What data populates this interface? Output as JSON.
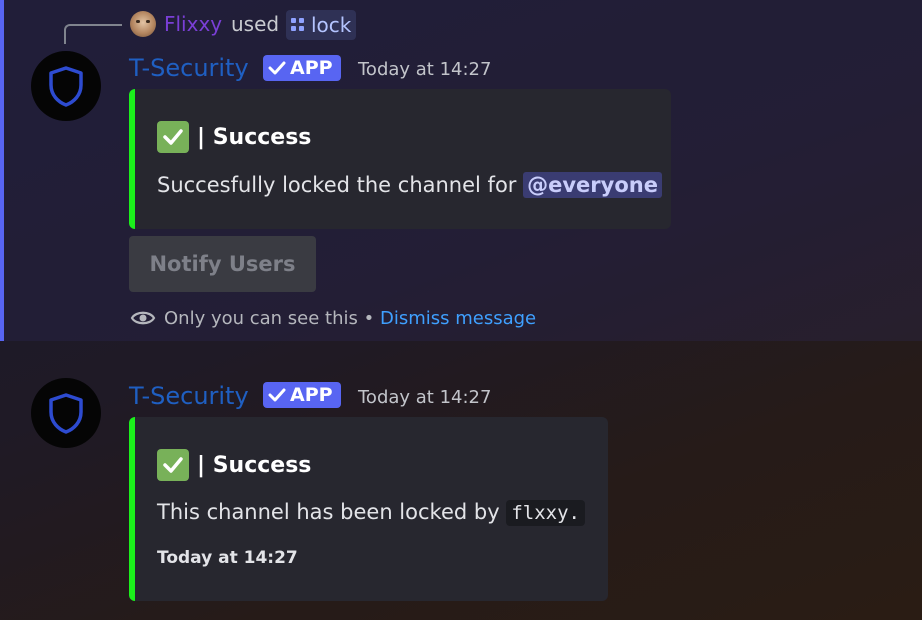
{
  "reply": {
    "user_name": "Flixxy",
    "used_text": "used",
    "command": "lock"
  },
  "messages": [
    {
      "bot_name": "T-Security",
      "badge": "APP",
      "timestamp": "Today at 14:27",
      "embed": {
        "title": "| Success",
        "description": "Succesfully locked the channel for ",
        "mention": "@everyone"
      },
      "button": "Notify Users",
      "ephemeral": {
        "text": "Only you can see this • ",
        "dismiss": "Dismiss message"
      }
    },
    {
      "bot_name": "T-Security",
      "badge": "APP",
      "timestamp": "Today at 14:27",
      "embed": {
        "title": "| Success",
        "description": "This channel has been locked by ",
        "code": "flxxy.",
        "footer": "Today at 14:27"
      }
    }
  ],
  "colors": {
    "accent": "#5865f2",
    "embed_border": "#1bf01b",
    "bot_name": "#1f5fc2",
    "reply_name": "#7a3fd6",
    "link": "#3fa0ff"
  },
  "icons": [
    "shield-icon",
    "checkmark-icon",
    "eye-icon",
    "slash-command-icon"
  ]
}
